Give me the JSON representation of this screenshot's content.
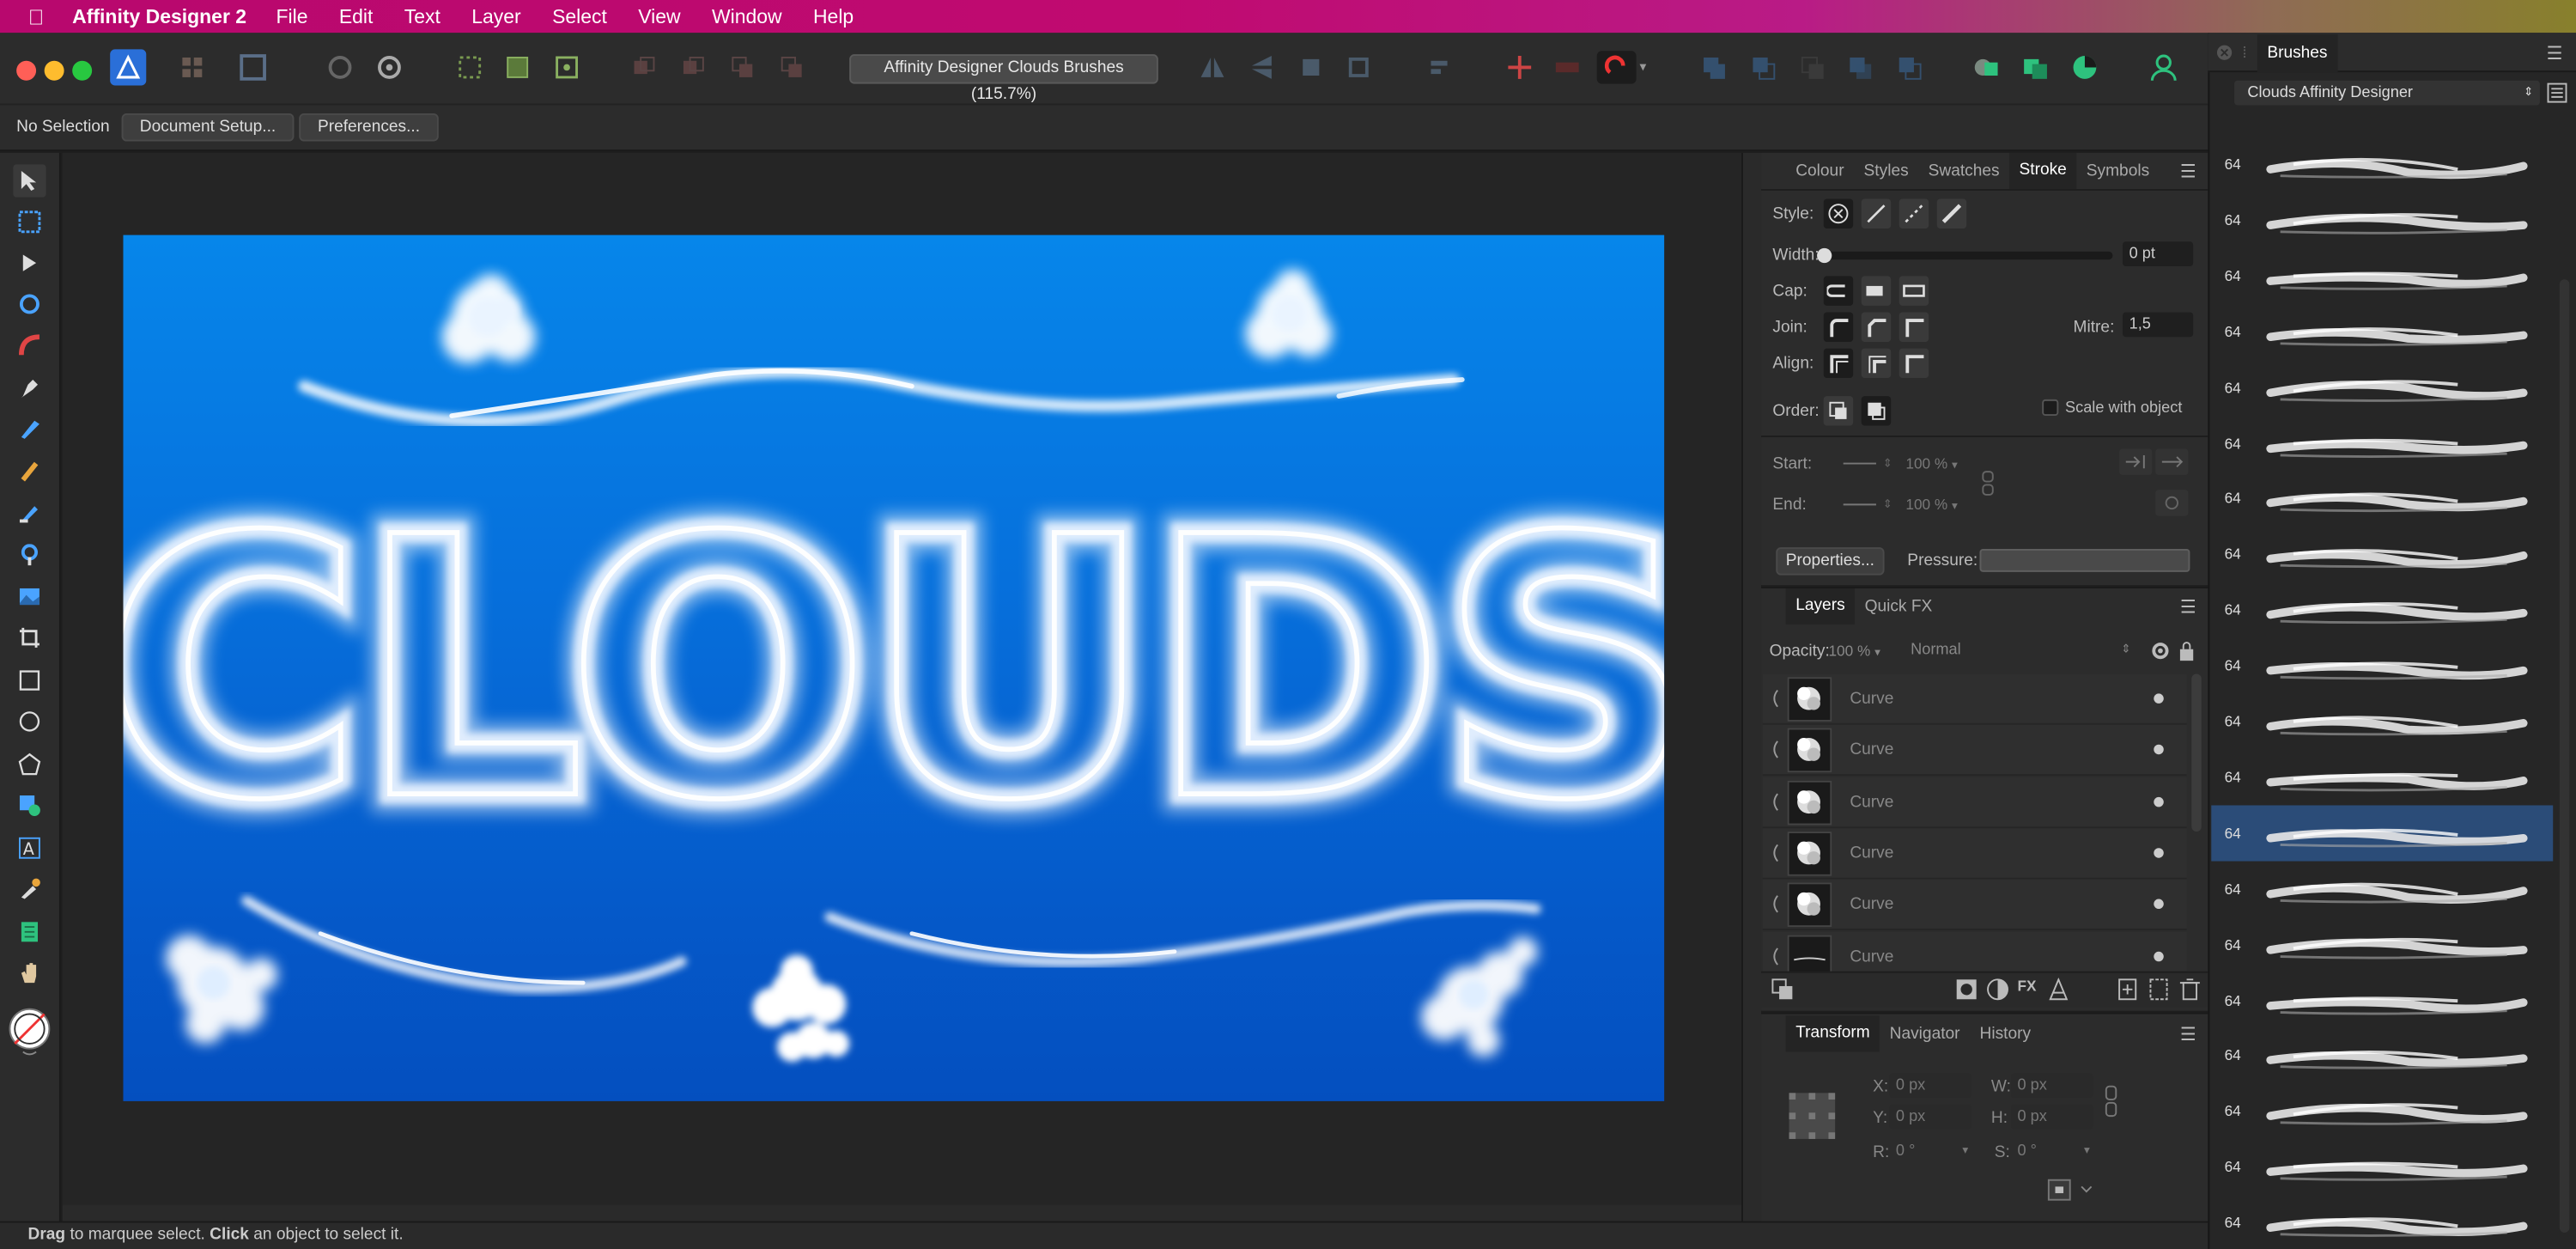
{
  "menubar": {
    "app_name": "Affinity Designer 2",
    "items": [
      "File",
      "Edit",
      "Text",
      "Layer",
      "Select",
      "View",
      "Window",
      "Help"
    ]
  },
  "toolbar": {
    "document_title": "Affinity Designer Clouds Brushes (115.7%)"
  },
  "context": {
    "selection": "No Selection",
    "document_setup": "Document Setup...",
    "preferences": "Preferences..."
  },
  "canvas": {
    "artwork_text": "CLOUDS"
  },
  "stroke_panel": {
    "tabs": [
      "Colour",
      "Styles",
      "Swatches",
      "Stroke",
      "Symbols"
    ],
    "active_tab": "Stroke",
    "style_label": "Style:",
    "width_label": "Width:",
    "width_value": "0 pt",
    "width_level": 0,
    "cap_label": "Cap:",
    "join_label": "Join:",
    "mitre_label": "Mitre:",
    "mitre_value": "1,5",
    "align_label": "Align:",
    "order_label": "Order:",
    "scale_with_object": "Scale with object",
    "start_label": "Start:",
    "start_value": "100 %",
    "end_label": "End:",
    "end_value": "100 %",
    "properties_button": "Properties...",
    "pressure_label": "Pressure:"
  },
  "layers_panel": {
    "tabs": [
      "Layers",
      "Quick FX"
    ],
    "active_tab": "Layers",
    "opacity_label": "Opacity:",
    "opacity_value": "100 %",
    "blend_mode": "Normal",
    "layers": [
      {
        "name": "Curve"
      },
      {
        "name": "Curve"
      },
      {
        "name": "Curve"
      },
      {
        "name": "Curve"
      },
      {
        "name": "Curve"
      },
      {
        "name": "Curve"
      }
    ]
  },
  "transform_panel": {
    "tabs": [
      "Transform",
      "Navigator",
      "History"
    ],
    "active_tab": "Transform",
    "x_label": "X:",
    "x_value": "0 px",
    "y_label": "Y:",
    "y_value": "0 px",
    "w_label": "W:",
    "w_value": "0 px",
    "h_label": "H:",
    "h_value": "0 px",
    "r_label": "R:",
    "r_value": "0 °",
    "s_label": "S:",
    "s_value": "0 °"
  },
  "brushes_panel": {
    "title": "Brushes",
    "category": "Clouds Affinity Designer",
    "brushes": [
      {
        "size": "64"
      },
      {
        "size": "64"
      },
      {
        "size": "64"
      },
      {
        "size": "64"
      },
      {
        "size": "64"
      },
      {
        "size": "64"
      },
      {
        "size": "64"
      },
      {
        "size": "64"
      },
      {
        "size": "64"
      },
      {
        "size": "64"
      },
      {
        "size": "64"
      },
      {
        "size": "64"
      },
      {
        "size": "64",
        "selected": true
      },
      {
        "size": "64"
      },
      {
        "size": "64"
      },
      {
        "size": "64"
      },
      {
        "size": "64"
      },
      {
        "size": "64"
      },
      {
        "size": "64"
      },
      {
        "size": "64"
      }
    ]
  },
  "statusbar": {
    "drag": "Drag",
    "drag_text": " to marquee select. ",
    "click": "Click",
    "click_text": " an object to select it."
  },
  "colors": {
    "accent": "#2f6fd6",
    "menubar_start": "#b8086e",
    "canvas_top": "#0686ea",
    "canvas_bottom": "#044fbf",
    "selected_brush": "#2b4c78"
  }
}
